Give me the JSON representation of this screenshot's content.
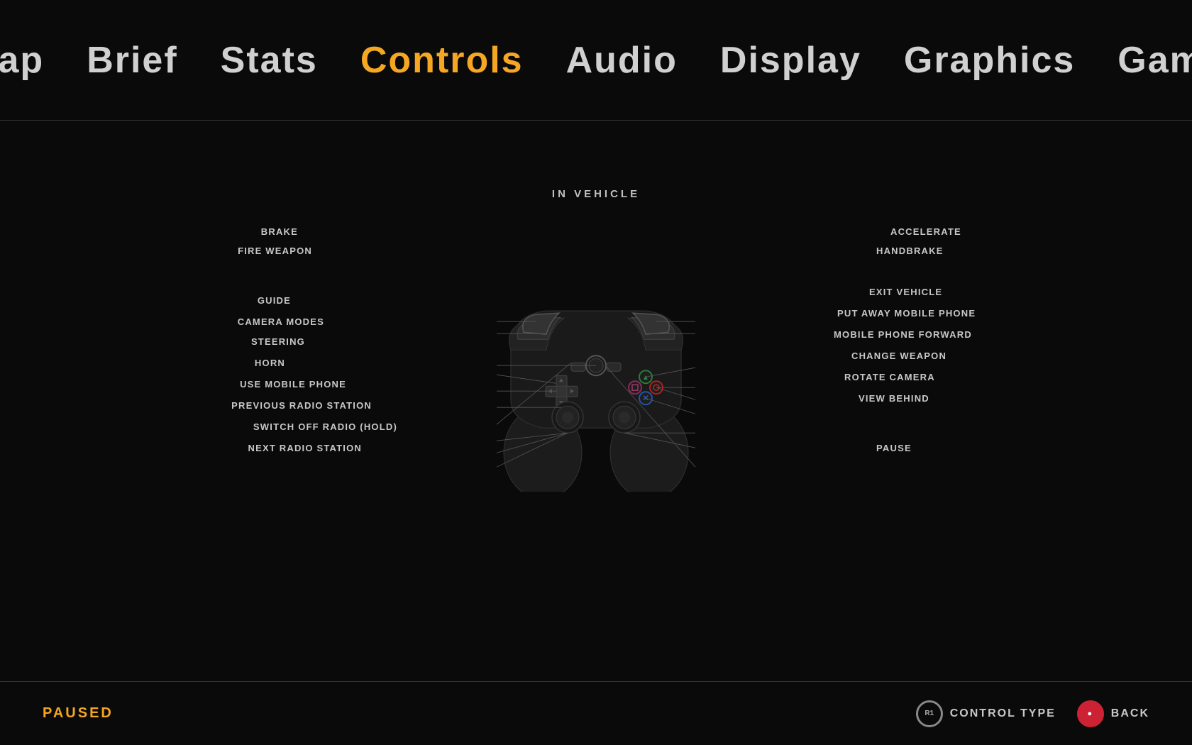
{
  "nav": {
    "items": [
      {
        "label": "Map",
        "active": false
      },
      {
        "label": "Brief",
        "active": false
      },
      {
        "label": "Stats",
        "active": false
      },
      {
        "label": "Controls",
        "active": true
      },
      {
        "label": "Audio",
        "active": false
      },
      {
        "label": "Display",
        "active": false
      },
      {
        "label": "Graphics",
        "active": false
      },
      {
        "label": "Game",
        "active": false
      }
    ]
  },
  "diagram": {
    "title": "IN VEHICLE",
    "left_labels": [
      "BRAKE",
      "FIRE WEAPON",
      "GUIDE",
      "CAMERA MODES",
      "STEERING",
      "HORN",
      "USE MOBILE PHONE",
      "PREVIOUS RADIO STATION",
      "SWITCH OFF RADIO (HOLD)",
      "NEXT RADIO STATION"
    ],
    "right_labels": [
      "ACCELERATE",
      "HANDBRAKE",
      "EXIT VEHICLE",
      "PUT AWAY MOBILE PHONE",
      "MOBILE PHONE FORWARD",
      "CHANGE WEAPON",
      "ROTATE CAMERA",
      "VIEW BEHIND",
      "PAUSE"
    ]
  },
  "footer": {
    "paused_label": "PAUSED",
    "control_type_label": "CONTROL TYPE",
    "back_label": "BACK",
    "r1_label": "R1",
    "circle_symbol": "●"
  }
}
